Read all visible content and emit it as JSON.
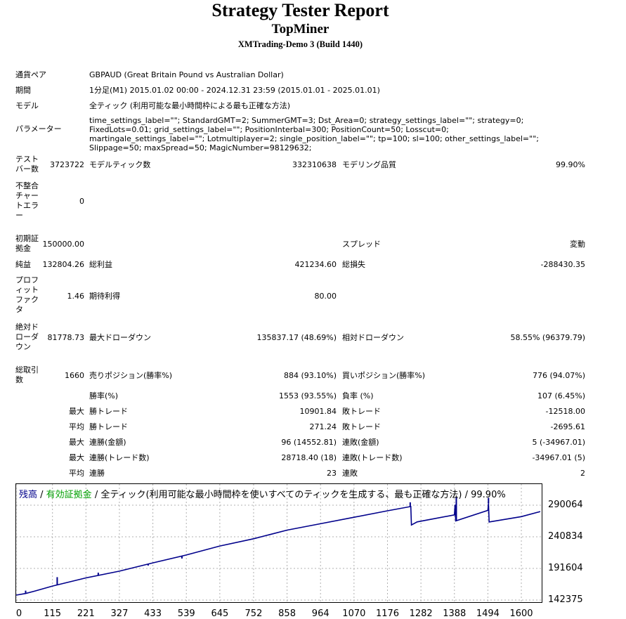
{
  "header": {
    "title": "Strategy Tester Report",
    "expert": "TopMiner",
    "server": "XMTrading-Demo 3 (Build 1440)"
  },
  "settings": {
    "symbol_label": "通貨ペア",
    "symbol_value": "GBPAUD (Great Britain Pound vs Australian Dollar)",
    "period_label": "期間",
    "period_value": "1分足(M1) 2015.01.02 00:00 - 2024.12.31 23:59 (2015.01.01 - 2025.01.01)",
    "model_label": "モデル",
    "model_value": "全ティック (利用可能な最小時間枠による最も正確な方法)",
    "params_label": "パラメーター",
    "params_value": "time_settings_label=\"\"; StandardGMT=2; SummerGMT=3; Dst_Area=0; strategy_settings_label=\"\"; strategy=0; FixedLots=0.01; grid_settings_label=\"\"; PositionInterbal=300; PositionCount=50; Losscut=0; martingale_settings_label=\"\"; Lotmultiplayer=2; single_position_label=\"\"; tp=100; sl=100; other_settings_label=\"\"; Slippage=50; maxSpread=50; MagicNumber=98129632;"
  },
  "stats": {
    "bars_label": "テストバー数",
    "bars_value": "3723722",
    "ticks_label": "モデルティック数",
    "ticks_value": "332310638",
    "quality_label": "モデリング品質",
    "quality_value": "99.90%",
    "mismatch_label": "不整合チャートエラー",
    "mismatch_value": "0",
    "deposit_label": "初期証拠金",
    "deposit_value": "150000.00",
    "spread_label": "スプレッド",
    "spread_value": "変動",
    "net_label": "純益",
    "net_value": "132804.26",
    "gross_profit_label": "総利益",
    "gross_profit_value": "421234.60",
    "gross_loss_label": "総損失",
    "gross_loss_value": "-288430.35",
    "pf_label": "プロフィットファクタ",
    "pf_value": "1.46",
    "expected_label": "期待利得",
    "expected_value": "80.00",
    "abs_dd_label": "絶対ドローダウン",
    "abs_dd_value": "81778.73",
    "max_dd_label": "最大ドローダウン",
    "max_dd_value": "135837.17 (48.69%)",
    "rel_dd_label": "相対ドローダウン",
    "rel_dd_value": "58.55% (96379.79)",
    "total_trades_label": "総取引数",
    "total_trades_value": "1660",
    "short_label": "売りポジション(勝率%)",
    "short_value": "884 (93.10%)",
    "long_label": "買いポジション(勝率%)",
    "long_value": "776 (94.07%)",
    "win_pct_label": "勝率(%)",
    "win_pct_value": "1553 (93.55%)",
    "loss_pct_label": "負率 (%)",
    "loss_pct_value": "107 (6.45%)",
    "max_prefix": "最大",
    "avg_prefix": "平均",
    "largest_win_label": "勝トレード",
    "largest_win_value": "10901.84",
    "largest_loss_label": "敗トレード",
    "largest_loss_value": "-12518.00",
    "avg_win_label": "勝トレード",
    "avg_win_value": "271.24",
    "avg_loss_label": "敗トレード",
    "avg_loss_value": "-2695.61",
    "max_cons_wins_label": "連勝(金額)",
    "max_cons_wins_value": "96 (14552.81)",
    "max_cons_losses_label": "連敗(金額)",
    "max_cons_losses_value": "5 (-34967.01)",
    "max_cons_profit_label": "連勝(トレード数)",
    "max_cons_profit_value": "28718.40 (18)",
    "max_cons_loss_label": "連敗(トレード数)",
    "max_cons_loss_value": "-34967.01 (5)",
    "avg_cons_wins_label": "連勝",
    "avg_cons_wins_value": "23",
    "avg_cons_losses_label": "連敗",
    "avg_cons_losses_value": "2"
  },
  "chart_data": {
    "type": "line",
    "legend": {
      "balance": "残高",
      "sep1": " / ",
      "equity": "有効証拠金",
      "rest": " / 全ティック(利用可能な最小時間枠を使いすべてのティックを生成する、最も正確な方法) / 99.90%"
    },
    "colors": {
      "balance": "#00008b",
      "equity": "#00a000"
    },
    "y_ticks": [
      "290064",
      "240834",
      "191604",
      "142375"
    ],
    "x_ticks": [
      "0",
      "115",
      "221",
      "327",
      "433",
      "539",
      "645",
      "752",
      "858",
      "964",
      "1070",
      "1176",
      "1282",
      "1388",
      "1494",
      "1600"
    ],
    "xlim": [
      0,
      1660
    ],
    "ylim": [
      142375,
      290064
    ],
    "grid": true,
    "balance": [
      [
        0,
        150000
      ],
      [
        30,
        152500
      ],
      [
        58,
        156200
      ],
      [
        115,
        164200
      ],
      [
        221,
        176800
      ],
      [
        327,
        187300
      ],
      [
        433,
        200200
      ],
      [
        539,
        212500
      ],
      [
        645,
        226500
      ],
      [
        752,
        237800
      ],
      [
        858,
        251200
      ],
      [
        964,
        261200
      ],
      [
        1070,
        271200
      ],
      [
        1176,
        281300
      ],
      [
        1250,
        288000
      ],
      [
        1252,
        259200
      ],
      [
        1270,
        264000
      ],
      [
        1388,
        275000
      ],
      [
        1390,
        290800
      ],
      [
        1392,
        265600
      ],
      [
        1494,
        282000
      ],
      [
        1496,
        293000
      ],
      [
        1498,
        263900
      ],
      [
        1600,
        272200
      ],
      [
        1660,
        280100
      ]
    ],
    "spikes": [
      [
        30,
        157000
      ],
      [
        130,
        178000
      ],
      [
        260,
        185000
      ],
      [
        418,
        196000
      ],
      [
        525,
        207000
      ],
      [
        1248,
        294500
      ],
      [
        1394,
        302000
      ],
      [
        1496,
        301500
      ]
    ]
  }
}
